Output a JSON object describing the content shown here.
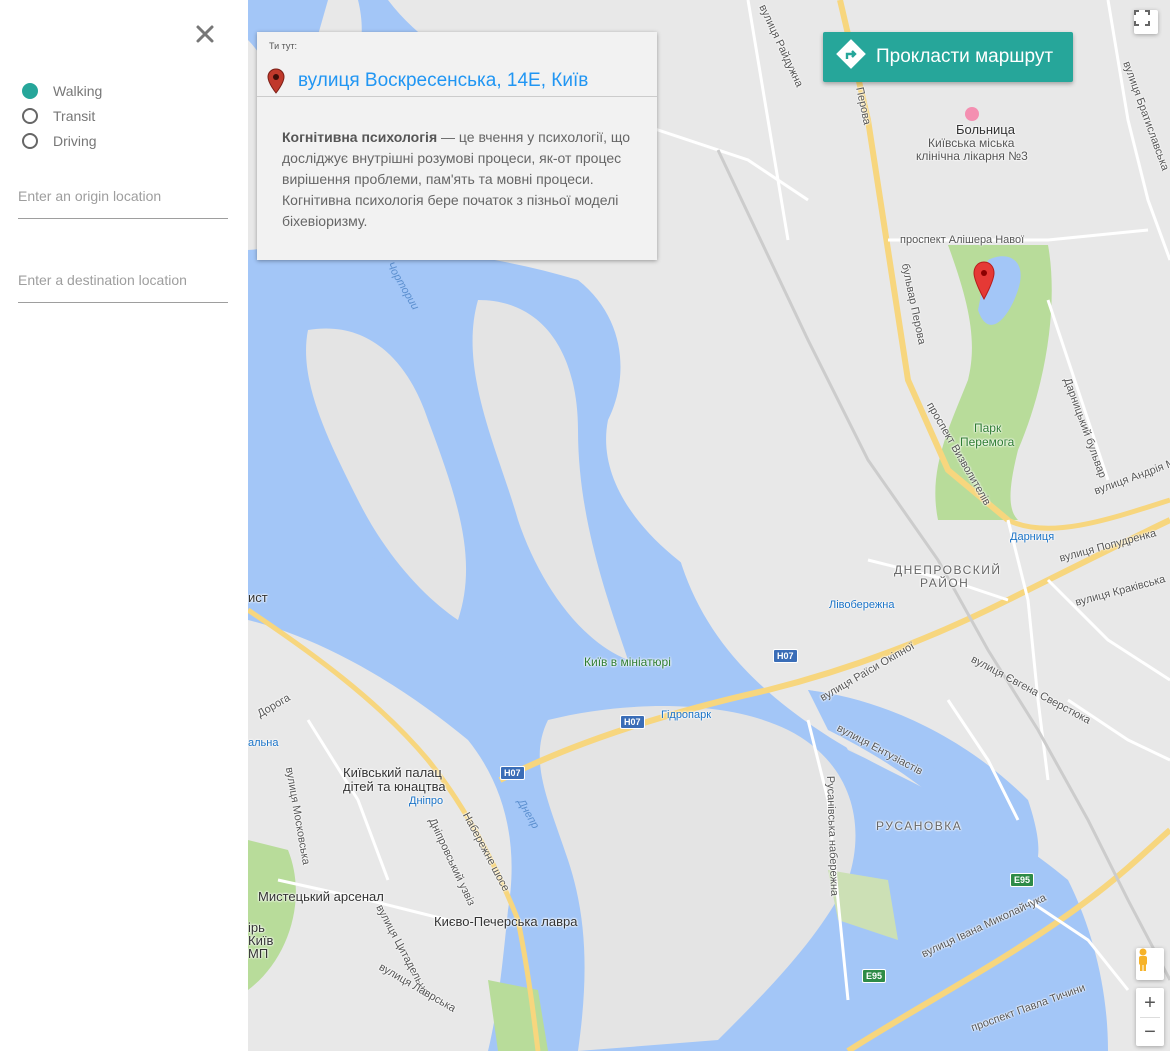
{
  "sidebar": {
    "close_icon": "close-icon",
    "modes": [
      {
        "label": "Walking",
        "selected": true
      },
      {
        "label": "Transit",
        "selected": false
      },
      {
        "label": "Driving",
        "selected": false
      }
    ],
    "origin_placeholder": "Enter an origin location",
    "destination_placeholder": "Enter a destination location"
  },
  "info_window": {
    "hint": "Ти тут:",
    "address": "вулиця Воскресенська, 14Е, Київ",
    "description_bold": "Когнітивна психологія",
    "description_rest": " — це вчення у психології, що досліджує внутрішні розумові процеси, як-от процес вирішення проблеми, пам'ять та мовні процеси. Когнітивна психологія бере початок з пізньої моделі біхевіоризму."
  },
  "route_button": {
    "label": "Прокласти маршрут",
    "icon": "directions-icon"
  },
  "map_controls": {
    "zoom_in": "+",
    "zoom_out": "−",
    "fullscreen_icon": "fullscreen-icon",
    "pegman_icon": "pegman-icon"
  },
  "colors": {
    "accent": "#26a69a",
    "water": "#a3c6f7",
    "park": "#b8dc9a",
    "road_major": "#f7d67e",
    "land": "#e8e8e8",
    "link": "#2196f3"
  },
  "map_labels": {
    "hospital_1": "Больница",
    "hospital_2": "Київська міська",
    "hospital_3": "клінічна лікарня №3",
    "park_1": "Парк",
    "park_2": "Перемога",
    "district_dnipro_1": "ДНЕПРОВСКИЙ",
    "district_dnipro_2": "РАЙОН",
    "rusanovka": "РУСАНОВКА",
    "kyiv_miniature": "Київ в мініатюрі",
    "palace_1": "Київський палац",
    "palace_2": "дітей та юнацтва",
    "arsenal": "Мистецький арсенал",
    "lavra": "Києво-Печерська лавра",
    "metro_darnytsia": "Дарниця",
    "metro_livoberezhna": "Лівобережна",
    "metro_hidropark": "Гідропарк",
    "metro_dnipro": "Дніпро",
    "metro_partial": "альна",
    "river_dnipro": "Днепр",
    "river_chortoroi": "Чортории",
    "st_alishera": "проспект Алішера Навої",
    "st_perova": "бульвар Перова",
    "st_perova_top": "Перова",
    "st_vyzvoliteliv": "проспект Визволителів",
    "st_raiduzhna": "вулиця Райдужна",
    "st_bratyslavska": "вулиця Братиславська",
    "st_popudrenka": "вулиця Попудренка",
    "st_kraykivska": "вулиця Краківська",
    "st_raisy": "вулиця Раїси Окіпної",
    "st_sverstiuka": "вулиця Євгена Сверстюка",
    "st_entuziastiv": "вулиця Ентузіастів",
    "st_rusanivska": "Русанівська набережна",
    "st_naberezhne": "Набережне шосе",
    "st_dniprovsky": "Дніпровський узвіз",
    "st_moskovska": "вулиця Московська",
    "st_tsytadelna": "вулиця Цитадельна",
    "st_lavrska": "вулиця Лаврська",
    "st_mykolaichuka": "вулиця Івана Миколайчука",
    "st_tychyny": "проспект Павла Тичини",
    "st_darnytskyi": "Дарницький бульвар",
    "st_andriia": "вулиця Андрія Ма",
    "st_dorohа": "Дорога",
    "partial_ist": "ист",
    "partial_pyr": "ірь",
    "partial_kyi": "Київ",
    "partial_mp": "МП"
  },
  "road_shields": {
    "h07_a": "H07",
    "h07_b": "H07",
    "h07_c": "H07",
    "e95_a": "E95",
    "e95_b": "E95"
  }
}
